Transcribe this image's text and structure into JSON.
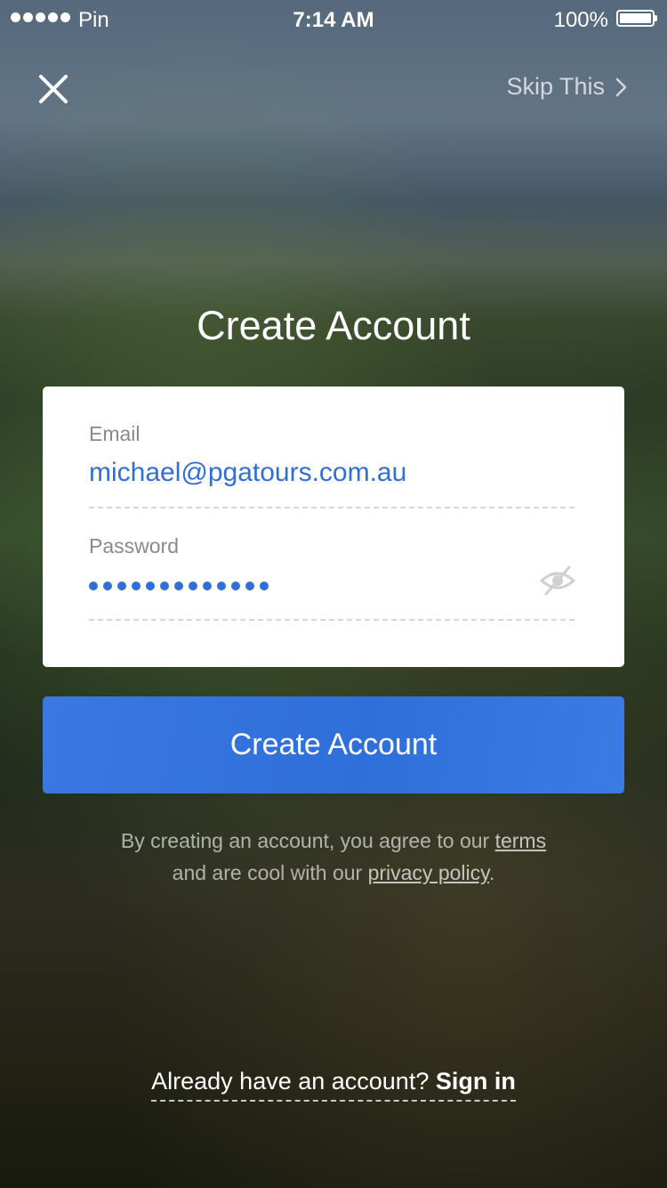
{
  "status_bar": {
    "carrier": "Pin",
    "time": "7:14 AM",
    "battery_percent": "100%"
  },
  "nav": {
    "close_icon": "close-icon",
    "skip_label": "Skip This",
    "skip_icon": "chevron-right-icon"
  },
  "title": "Create Account",
  "form": {
    "email_label": "Email",
    "email_value": "michael@pgatours.com.au",
    "password_label": "Password",
    "password_length": 13,
    "password_toggle_icon": "eye-slash-icon"
  },
  "submit_label": "Create Account",
  "legal": {
    "prefix": "By creating an account, you agree to our",
    "terms_link": "terms",
    "middle": "and are cool with our",
    "privacy_link": "privacy policy",
    "suffix": "."
  },
  "signin": {
    "prompt": "Already have an account?",
    "link": "Sign in"
  },
  "colors": {
    "accent": "#2f6fd6",
    "button": "#3374e0"
  }
}
